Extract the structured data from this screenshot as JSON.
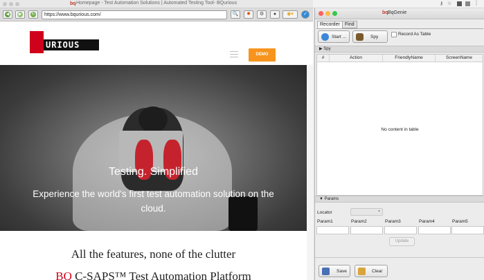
{
  "browser": {
    "window_title": "Homepage - Test Automation Solutions | Automated Testing Tool- BQurious",
    "title_logo": "bq",
    "url": "https://www.bqurious.com/"
  },
  "site": {
    "logo_text": "URIOUS",
    "demo_button": "DEMO",
    "hero_title": "Testing. Simplified",
    "hero_subtitle": "Experience the world's first test automation solution on the cloud.",
    "features_title": "All the features, none of the clutter",
    "platform_prefix": "BQ",
    "platform_rest": " C-SAPS™ Test Automation Platform"
  },
  "genie": {
    "window_title": "BqGenie",
    "title_logo": "bq",
    "tabs": [
      "Recorder",
      "Find"
    ],
    "start_button": "Start ...",
    "spy_button": "Spy",
    "record_as_table_label": "Record As Table",
    "spy_section": "Spy",
    "table_columns": [
      "#",
      "Action",
      "FriendlyName",
      "ScreenName"
    ],
    "empty_message": "No content in table",
    "params_section": "Params",
    "locator_label": "Locator",
    "param_labels": [
      "Param1",
      "Param2",
      "Param3",
      "Param4",
      "Param5"
    ],
    "update_button": "Update",
    "save_button": "Save",
    "clear_button": "Clear"
  },
  "colors": {
    "brand_red": "#d0011b",
    "demo_orange": "#f7941d"
  }
}
